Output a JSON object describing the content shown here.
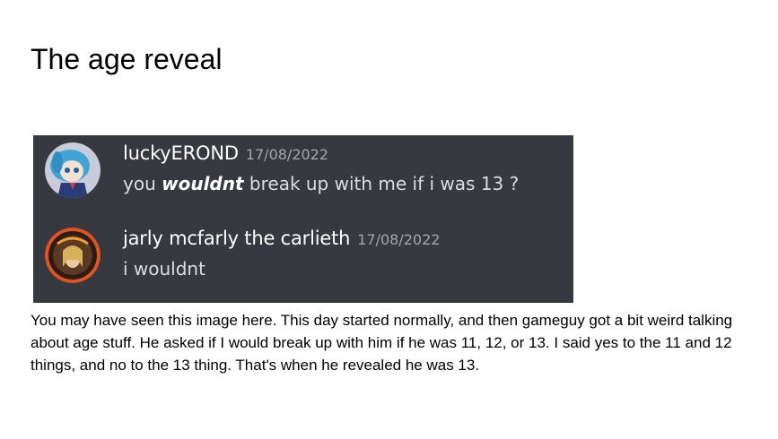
{
  "title": "The age reveal",
  "chat": {
    "messages": [
      {
        "username": "luckyEROND",
        "timestamp": "17/08/2022",
        "text_before": "you ",
        "text_emphasis": "wouldnt",
        "text_after": " break up with me if i was 13 ?",
        "avatar": "anime-character-avatar"
      },
      {
        "username": "jarly mcfarly the carlieth",
        "timestamp": "17/08/2022",
        "text": "i wouldnt",
        "avatar": "anime-character-avatar-orange-ring"
      }
    ],
    "colors": {
      "background": "#36393f",
      "username": "#ffffff",
      "timestamp": "#a3a6aa",
      "text": "#dcddde"
    }
  },
  "caption": "You may have seen this image here. This day started normally, and then gameguy got a bit weird talking about age stuff. He asked if I would break up with him if he was 11, 12, or 13. I said yes to the 11 and 12 things, and no to the 13 thing. That's when he revealed he was 13."
}
